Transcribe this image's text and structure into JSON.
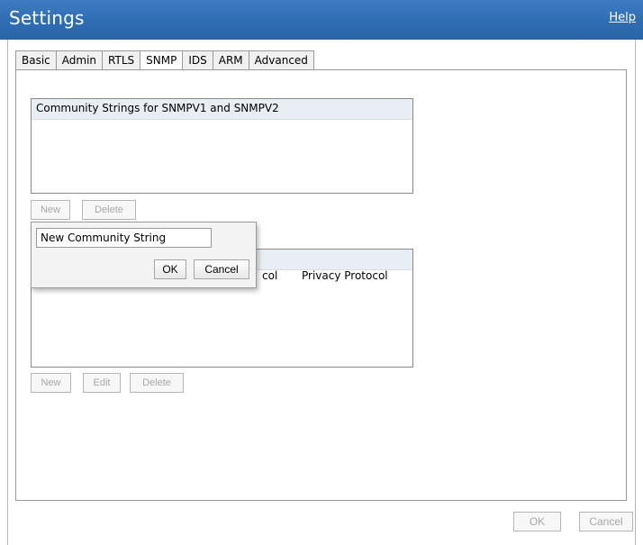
{
  "header": {
    "title": "Settings",
    "help_link": "Help"
  },
  "tabs": [
    {
      "label": "Basic",
      "active": false
    },
    {
      "label": "Admin",
      "active": false
    },
    {
      "label": "RTLS",
      "active": false
    },
    {
      "label": "SNMP",
      "active": true
    },
    {
      "label": "IDS",
      "active": false
    },
    {
      "label": "ARM",
      "active": false
    },
    {
      "label": "Advanced",
      "active": false
    }
  ],
  "community_strings": {
    "header": "Community Strings for SNMPV1 and SNMPV2",
    "rows": [],
    "new_label": "New",
    "delete_label": "Delete"
  },
  "snmpv3_users": {
    "partial_column_auth": "col",
    "column_privacy": "Privacy Protocol",
    "rows": [],
    "new_label": "New",
    "edit_label": "Edit",
    "delete_label": "Delete"
  },
  "popup": {
    "input_value": "New Community String",
    "ok_label": "OK",
    "cancel_label": "Cancel"
  },
  "footer": {
    "ok_label": "OK",
    "cancel_label": "Cancel"
  },
  "colors": {
    "titlebar": "#2f6db3",
    "disabled_text": "#a7a7a7",
    "list_header": "#e8eef3"
  }
}
